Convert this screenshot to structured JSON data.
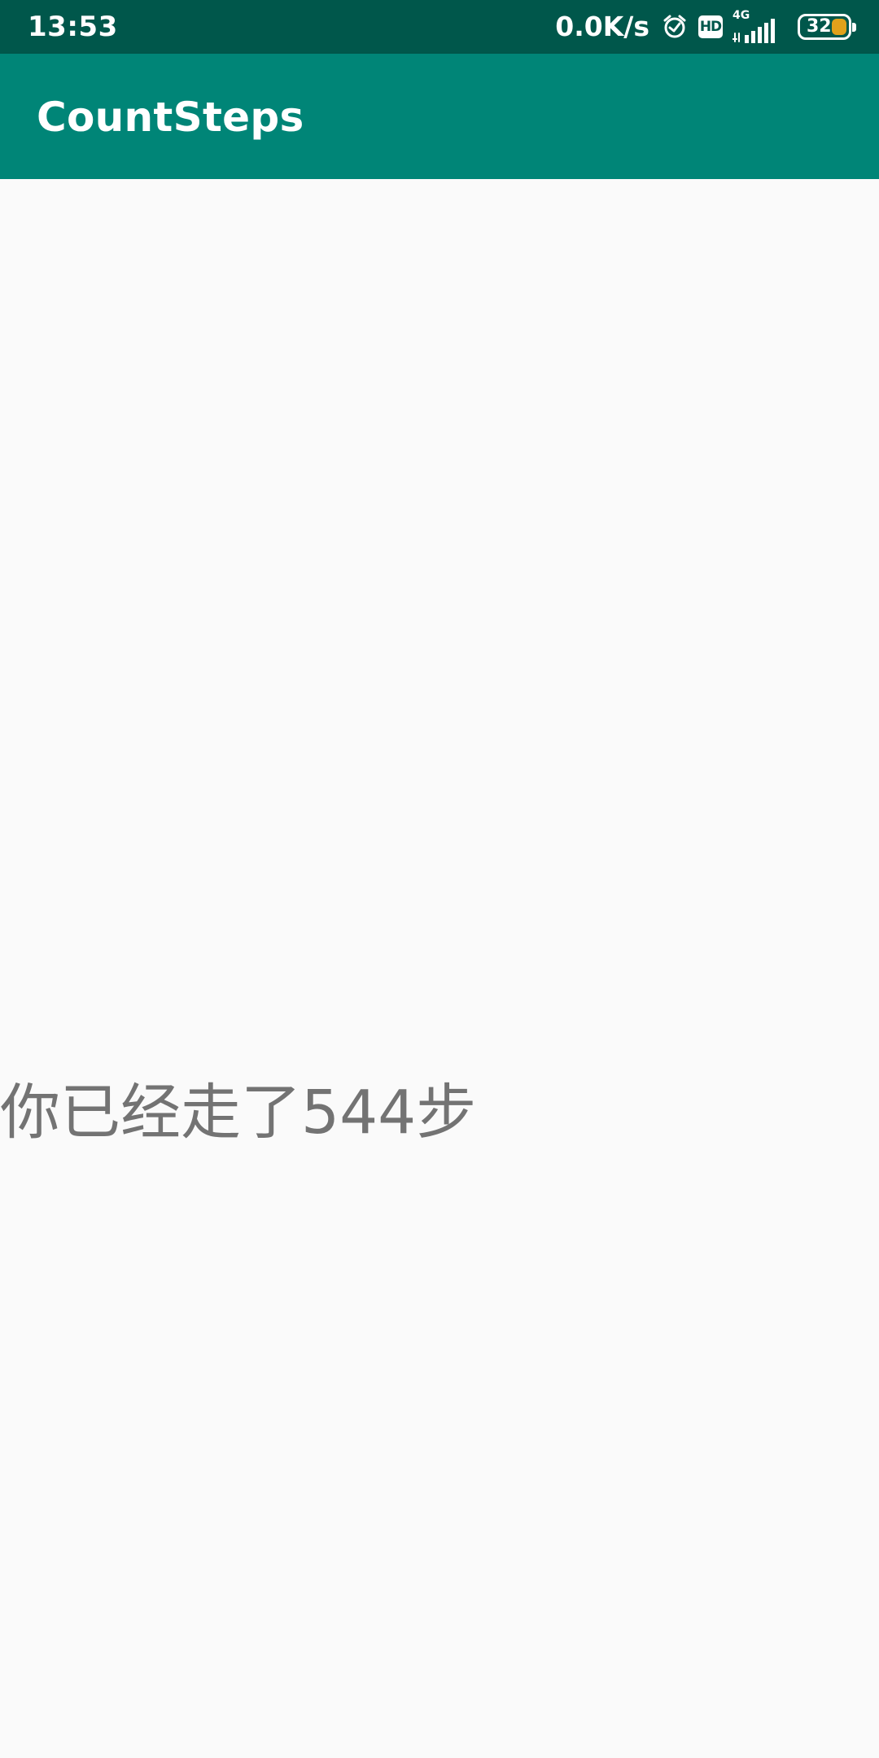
{
  "status_bar": {
    "time": "13:53",
    "network_speed": "0.0K/s",
    "alarm_icon": "alarm-clock-icon",
    "hd_label": "HD",
    "network_type": "4G",
    "signal_icon": "cellular-signal-icon",
    "battery_level": "32",
    "battery_fill_color": "#e0a11b"
  },
  "app_bar": {
    "title": "CountSteps",
    "color": "#008577"
  },
  "main": {
    "step_message": "你已经走了544步"
  },
  "colors": {
    "status_bar": "#00574b",
    "background": "#fafafa",
    "message_text": "#737373"
  }
}
